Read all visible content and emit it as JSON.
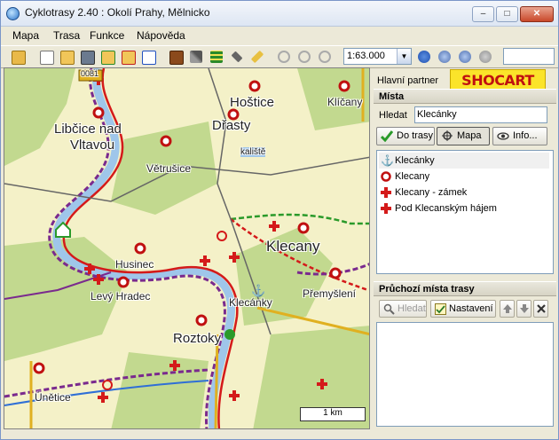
{
  "window": {
    "title": "Cyklotrasy 2.40 : Okolí Prahy, Mělnicko",
    "minimize": "–",
    "maximize": "□",
    "close": "✕"
  },
  "menu": [
    {
      "label": "Mapa"
    },
    {
      "label": "Trasa"
    },
    {
      "label": "Funkce"
    },
    {
      "label": "Nápověda"
    }
  ],
  "toolbar": {
    "icons": [
      "open-folder-icon",
      "new-document-icon",
      "open-icon",
      "save-icon",
      "import-icon",
      "export-icon",
      "export2-icon",
      "book-icon",
      "tools-icon",
      "grid-icon",
      "ruler-icon",
      "measure-icon",
      "undo-icon",
      "stop-icon",
      "redo-icon"
    ],
    "zoom_value": "1:63.000",
    "nav_icons": [
      "pan-icon",
      "zoom-in-icon",
      "zoom-out-icon"
    ]
  },
  "map": {
    "labels": [
      {
        "text": "0081",
        "kind": "sm"
      },
      {
        "text": "Libčice nad",
        "kind": "med"
      },
      {
        "text": "Vltavou",
        "kind": "med"
      },
      {
        "text": "Hoštice",
        "kind": "med"
      },
      {
        "text": "Klíčany",
        "kind": "sm"
      },
      {
        "text": "Dřasty",
        "kind": "med"
      },
      {
        "text": "Větrušice",
        "kind": "sm"
      },
      {
        "text": "kaliště",
        "kind": "sm"
      },
      {
        "text": "Husinec",
        "kind": "sm"
      },
      {
        "text": "Klecany",
        "kind": "big"
      },
      {
        "text": "Levý Hradec",
        "kind": "sm"
      },
      {
        "text": "Přemyšlení",
        "kind": "sm"
      },
      {
        "text": "Klecánky",
        "kind": "sm"
      },
      {
        "text": "Roztoky",
        "kind": "med"
      },
      {
        "text": "Únětice",
        "kind": "sm"
      }
    ],
    "scale_label": "1 km"
  },
  "panel": {
    "partner_label": "Hlavní partner",
    "partner_logo": "SHOCART",
    "mista_heading": "Místa",
    "search_label": "Hledat",
    "search_value": "Klecánky",
    "btn_do_trasy": "Do trasy",
    "btn_mapa": "Mapa",
    "btn_info": "Info...",
    "places": [
      {
        "label": "Klecánky",
        "icon": "anchor-icon"
      },
      {
        "label": "Klecany",
        "icon": "castle-ring-icon"
      },
      {
        "label": "Klecany - zámek",
        "icon": "red-cross-icon"
      },
      {
        "label": "Pod Klecanským hájem",
        "icon": "red-cross-icon"
      }
    ],
    "route_heading": "Průchozí místa trasy",
    "btn_hledat": "Hledat",
    "btn_nastaveni": "Nastavení"
  },
  "colors": {
    "route_red": "#d41a1a",
    "route_purple": "#7a2a8e",
    "route_blue": "#2f6fd6",
    "river": "#9fc6ea",
    "forest": "#c2d98f",
    "logo_yellow": "#fbe42a"
  }
}
